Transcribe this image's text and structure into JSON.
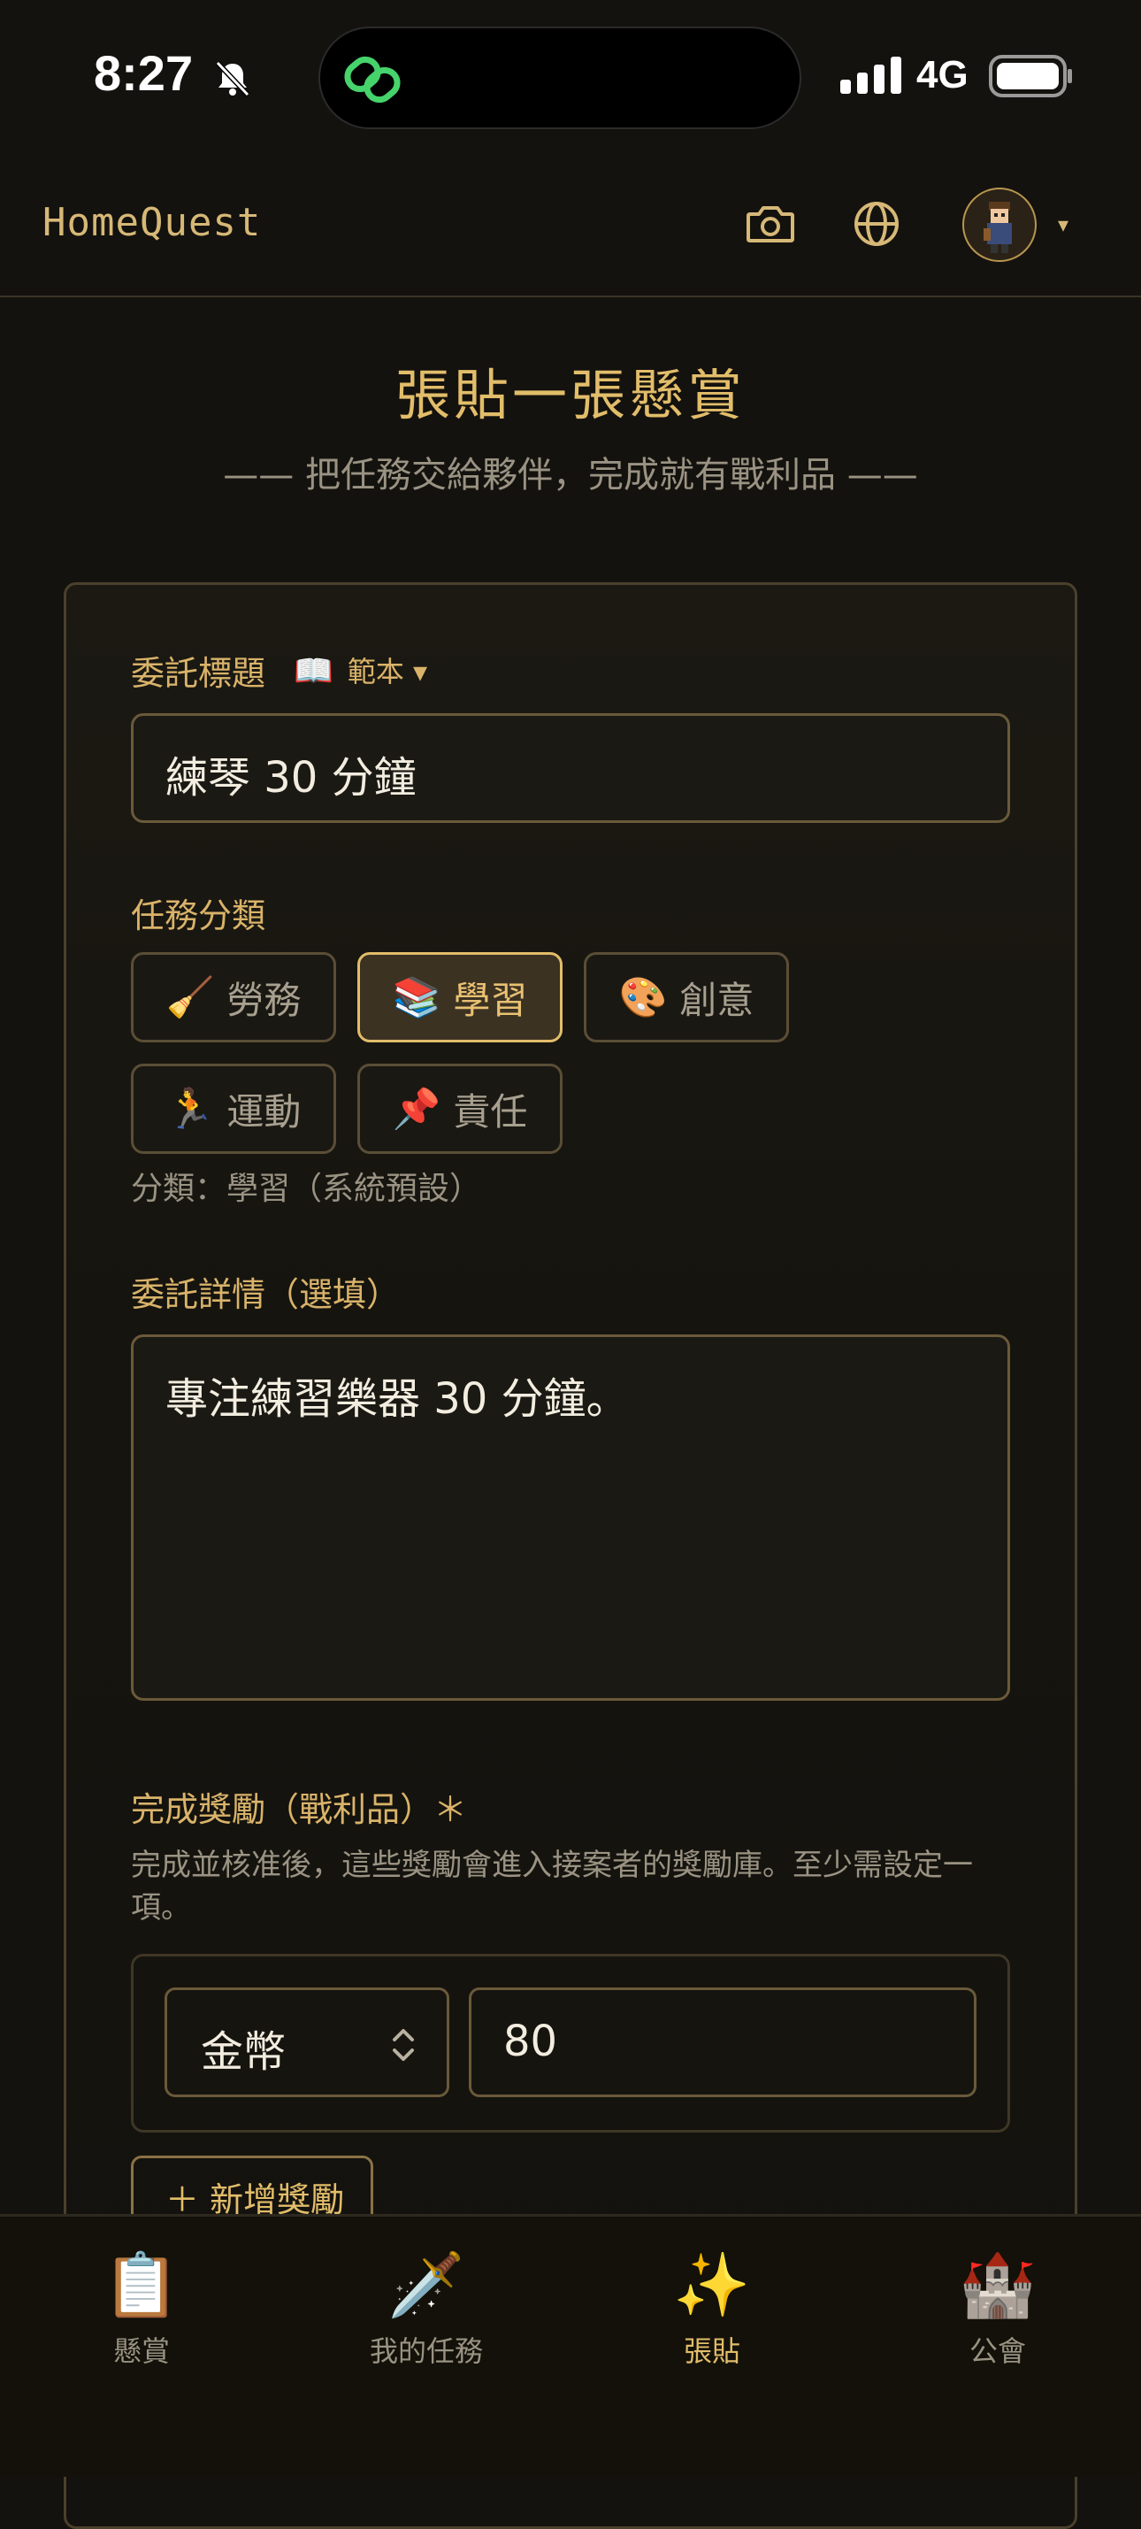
{
  "status_bar": {
    "time": "8:27",
    "network": "4G"
  },
  "header": {
    "brand": "HomeQuest",
    "avatar_caret": "▾"
  },
  "page": {
    "title": "張貼一張懸賞",
    "subtitle": "—— 把任務交給夥伴，完成就有戰利品 ——"
  },
  "form": {
    "title_label": "委託標題",
    "template_icon": "📖",
    "template_label": "範本 ▾",
    "title_value": "練琴 30 分鐘",
    "category_label": "任務分類",
    "categories": [
      {
        "icon": "🧹",
        "label": "勞務",
        "selected": false
      },
      {
        "icon": "📚",
        "label": "學習",
        "selected": true
      },
      {
        "icon": "🎨",
        "label": "創意",
        "selected": false
      },
      {
        "icon": "🏃",
        "label": "運動",
        "selected": false
      },
      {
        "icon": "📌",
        "label": "責任",
        "selected": false
      }
    ],
    "category_note": "分類：學習（系統預設）",
    "details_label": "委託詳情（選填）",
    "details_value": "專注練習樂器 30 分鐘。",
    "reward_label": "完成獎勵（戰利品）＊",
    "reward_desc": "完成並核准後，這些獎勵會進入接案者的獎勵庫。至少需設定一項。",
    "reward_type": "金幣",
    "reward_amount": "80",
    "add_reward": "＋ 新增獎勵"
  },
  "tabs": [
    {
      "icon": "📋",
      "label": "懸賞",
      "active": false
    },
    {
      "icon": "🗡️",
      "label": "我的任務",
      "active": false
    },
    {
      "icon": "✨",
      "label": "張貼",
      "active": true
    },
    {
      "icon": "🏰",
      "label": "公會",
      "active": false
    }
  ],
  "colors": {
    "accent": "#e2bd6a",
    "background": "#14120e",
    "muted": "#9a9383"
  }
}
